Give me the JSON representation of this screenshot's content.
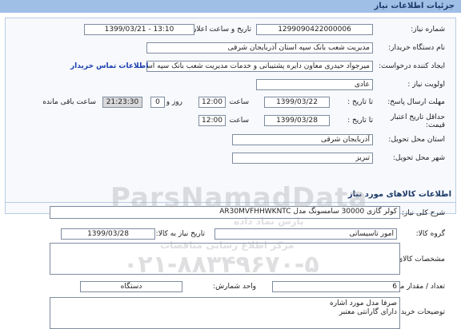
{
  "header": {
    "title": "جزئیات اطلاعات نیاز"
  },
  "need_info": {
    "need_number": {
      "label": "شماره نیاز:",
      "value": "1299090422000006"
    },
    "announce_datetime": {
      "label": "تاریخ و ساعت اعلان عمومی:",
      "value": "1399/03/21 - 13:10"
    },
    "buyer_org": {
      "label": "نام دستگاه خریدار:",
      "value": "مدیریت شعب بانک سپه استان آذربایجان شرقی"
    },
    "requester": {
      "label": "ایجاد کننده درخواست:",
      "value": "میرجواد حیدری معاون دایره پشتیبانی و خدمات مدیریت شعب بانک سپه استان آ"
    },
    "buyer_contact_link": "اطلاعات تماس خریدار",
    "priority": {
      "label": "اولویت نیاز :",
      "value": "عادی"
    },
    "reply_deadline": {
      "label": "مهلت ارسال پاسخ:",
      "to_date": "تا تاریخ :",
      "date": "1399/03/22",
      "time_label": "ساعت",
      "time": "12:00",
      "day_label": "روز و",
      "days": "0",
      "remaining_time": "21:23:30",
      "remaining_label": "ساعت باقی مانده"
    },
    "min_validity": {
      "label": "حداقل تاریخ اعتبار قیمت:",
      "to_date": "تا تاریخ :",
      "date": "1399/03/28",
      "time_label": "ساعت",
      "time": "12:00"
    },
    "delivery_province": {
      "label": "استان محل تحویل:",
      "value": "آذربایجان شرقی"
    },
    "delivery_city": {
      "label": "شهر محل تحویل:",
      "value": "تبریز"
    }
  },
  "goods_section": {
    "title": "اطلاعات کالاهای مورد نیاز",
    "general_desc": {
      "label": "شرح کلی نیاز:",
      "value": "کولر گازی 30000 سامسونگ مدل AR30MVFHHWKNTC"
    },
    "goods_group": {
      "label": "گروه کالا:",
      "value": "امور تاسیساتی"
    },
    "need_date": {
      "label": "تاریخ نیاز به کالا:",
      "value": "1399/03/28"
    },
    "goods_spec": {
      "label": "مشخصات کالای مورد نیاز:",
      "value": ""
    },
    "quantity": {
      "label": "تعداد / مقدار مورد نیاز:",
      "value": "6"
    },
    "unit": {
      "label": "واحد شمارش:",
      "value": "دستگاه"
    },
    "buyer_notes": {
      "label": "توضیحات خریدار:",
      "lines": [
        "صرفا مدل مورد اشاره",
        "دارای گارانتی معتبر"
      ]
    }
  },
  "watermark": {
    "brand": "ParsNamadData",
    "persian": "پارس نماد داده",
    "persian2": "مرکز اطلاع رسانی مناقصات",
    "phone": "۰۲۱-۸۸۳۴۹۶۷۰-۵"
  }
}
